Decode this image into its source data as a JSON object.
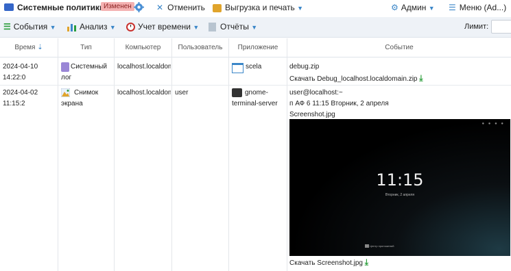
{
  "topbar": {
    "title": "Системные политики",
    "badge": "Изменен",
    "cancel": "Отменить",
    "export": "Выгрузка и печать",
    "user": "Админ",
    "menu": "Меню (Ad...)"
  },
  "toolbar": {
    "events": "События",
    "analysis": "Анализ",
    "time": "Учет времени",
    "reports": "Отчёты",
    "limit_label": "Лимит:",
    "limit_value": ""
  },
  "columns": {
    "time": "Время",
    "type": "Тип",
    "computer": "Компьютер",
    "user": "Пользователь",
    "app": "Приложение",
    "event": "Событие"
  },
  "rows": [
    {
      "time": "2024-04-10 14:22:0",
      "type_line1": "Системный",
      "type_line2": "лог",
      "computer": "localhost.localdom",
      "user": "",
      "app_line1": "scela",
      "app_line2": "",
      "event_line1": "debug.zip",
      "event_line2": "Скачать Debug_localhost.localdomain.zip"
    },
    {
      "time": "2024-04-02 11:15:2",
      "type_line1": "Снимок",
      "type_line2": "экрана",
      "computer": "localhost.localdom",
      "user": "user",
      "app_line1": "gnome-",
      "app_line2": "terminal-server",
      "event_line1": "user@localhost:~",
      "event_line2": "п АФ 6 11:15 Вторник, 2 апреля",
      "event_line3": "Screenshot.jpg",
      "event_line4": "Скачать Screenshot.jpg"
    }
  ],
  "screenshot": {
    "clock": "11:15",
    "date": "Вторник, 2 апреля",
    "app_center": "Центр приложений"
  }
}
